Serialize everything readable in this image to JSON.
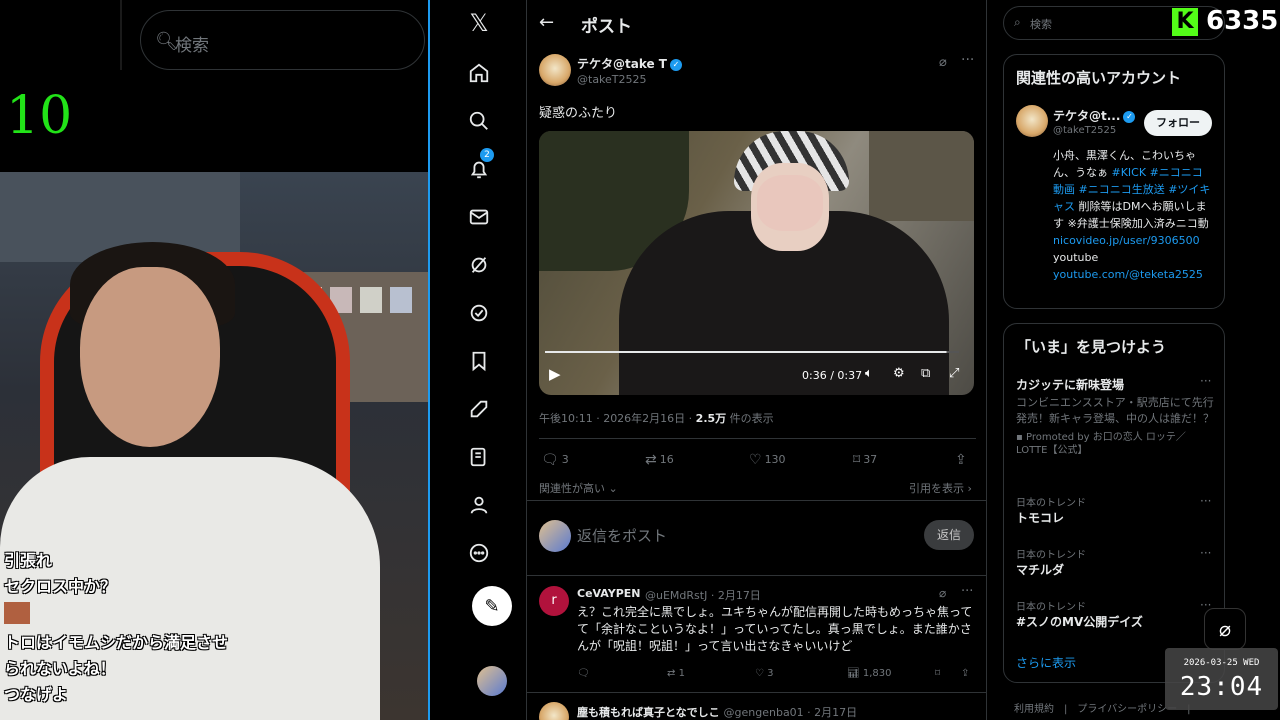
{
  "stream": {
    "search_placeholder": "検索",
    "counter": "10",
    "chat": [
      "引張れ",
      "セクロス中か？",
      "トロはイモムシだから満足させ",
      "られないよね！",
      "つなげよ"
    ]
  },
  "nav": {
    "notifications_badge": "2",
    "items": [
      "x-logo-icon",
      "home-icon",
      "explore-icon",
      "notifications-icon",
      "messages-icon",
      "grok-icon",
      "premium-icon",
      "bookmarks-icon",
      "jobs-icon",
      "articles-icon",
      "profile-icon",
      "more-icon",
      "post-compose-icon"
    ]
  },
  "main": {
    "title": "ポスト",
    "author": {
      "name": "テケタ@take T",
      "handle": "@takeT2525"
    },
    "text": "疑惑のふたり",
    "video": {
      "time": "0:36 / 0:37",
      "progress": 0.97
    },
    "meta": {
      "time": "午後10:11 · 2026年2月16日 · ",
      "views": "2.5万",
      "views_suffix": " 件の表示"
    },
    "actions": {
      "replies": "3",
      "reposts": "16",
      "likes": "130",
      "bookmarks": "37"
    },
    "sort_label": "関連性が高い",
    "quotes_link": "引用を表示",
    "reply_placeholder": "返信をポスト",
    "reply_button": "返信",
    "reply": {
      "avatar_letter": "r",
      "name": "CeVAYPEN",
      "handle": "@uEMdRstJ · 2月17日",
      "text": "え？これ完全に黒でしょ。ユキちゃんが配信再開した時もめっちゃ焦ってて「余計なこというなよ！」っていってたし。真っ黒でしょ。また誰かさんが「呪詛！呪詛！」って言い出さなきゃいいけど",
      "reposts": "1",
      "likes": "3",
      "views": "1,830"
    },
    "next_reply": {
      "name": "塵も積もれば真子となでしこ",
      "handle": "@gengenba01 · 2月17日"
    }
  },
  "sidebar": {
    "search_placeholder": "検索",
    "accounts_title": "関連性の高いアカウント",
    "account": {
      "name": "テケタ@t...",
      "handle": "@takeT2525",
      "follow": "フォロー",
      "bio_1": "小舟、黒澤くん、こわいちゃん、うなぁ ",
      "bio_tags": "#KICK #ニコニコ動画 #ニコニコ生放送 #ツイキャス",
      "bio_2": " 削除等はDMへお願いします ※弁護士保険加入済みニコ動",
      "link1": "nicovideo.jp/user/9306500",
      "bio_3": "youtube",
      "link2": "youtube.com/@teketa2525"
    },
    "trends_title": "「いま」を見つけよう",
    "promo": {
      "name": "カジッテに新味登場",
      "desc": "コンビニエンスストア・駅売店にて先行発売！新キャラ登場、中の人は誰だ！？",
      "by": "Promoted by お口の恋人 ロッテ／LOTTE【公式】"
    },
    "trends": [
      {
        "cat": "日本のトレンド",
        "name": "トモコレ"
      },
      {
        "cat": "日本のトレンド",
        "name": "マチルダ"
      },
      {
        "cat": "日本のトレンド",
        "name": "#スノのMV公開デイズ"
      }
    ],
    "show_more": "さらに表示",
    "footer": "利用規約　|　プライバシーポリシー　|"
  },
  "overlay": {
    "kick_count": "6335",
    "clock_date": "2026-03-25 WED",
    "clock_time": "23:04"
  },
  "colors": {
    "accent": "#1d9bf0",
    "kick_green": "#53fc18",
    "counter_green": "#22e318",
    "reply_avatar": "#b1123c"
  }
}
